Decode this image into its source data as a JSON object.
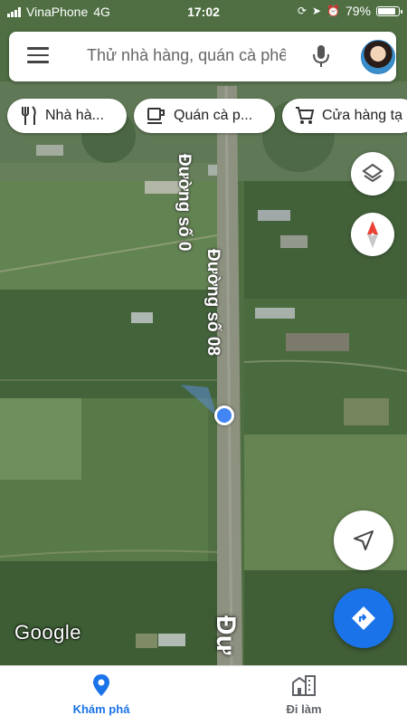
{
  "status_bar": {
    "carrier": "VinaPhone",
    "network": "4G",
    "time": "17:02",
    "battery_percent": "79%",
    "battery_level": 0.79
  },
  "search": {
    "placeholder": "Thử nhà hàng, quán cà phê",
    "menu_icon": "menu-icon",
    "mic_icon": "mic-icon",
    "avatar_icon": "user-avatar"
  },
  "chips": [
    {
      "label": "Nhà hà...",
      "icon": "restaurant-icon"
    },
    {
      "label": "Quán cà p...",
      "icon": "coffee-icon"
    },
    {
      "label": "Cửa hàng tạ",
      "icon": "shopping-cart-icon"
    }
  ],
  "map": {
    "road_label_1": "Đường số 08",
    "road_label_2": "Đường số 0",
    "road_label_bottom": "Đư",
    "attribution": "Google"
  },
  "controls": {
    "layers_icon": "layers-icon",
    "compass_icon": "compass-icon",
    "my_location_icon": "navigation-arrow-icon",
    "directions_icon": "directions-icon",
    "accent_color": "#1a73e8",
    "compass_red": "#ea4335"
  },
  "bottom_nav": {
    "explore_label": "Khám phá",
    "commute_label": "Đi làm",
    "active_color": "#1a73e8",
    "inactive_color": "#5f6368"
  }
}
